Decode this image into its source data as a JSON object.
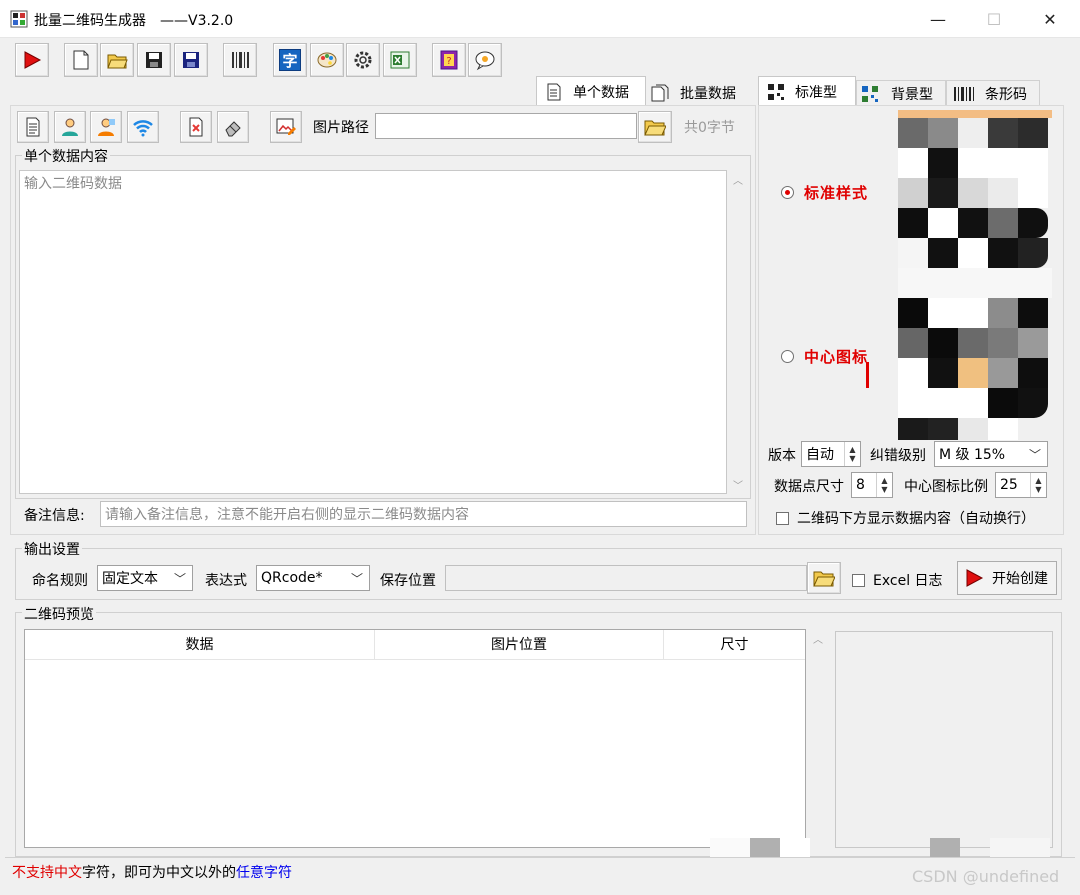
{
  "window": {
    "title": "批量二维码生成器　——V3.2.0",
    "minimize_glyph": "—",
    "maximize_glyph": "☐",
    "close_glyph": "✕"
  },
  "toolbar": {
    "buttons": [
      "play-icon",
      "new-file-icon",
      "open-folder-icon",
      "save-icon",
      "save-as-icon",
      "barcode-reader-icon",
      "font-icon",
      "palette-icon",
      "settings-icon",
      "excel-icon",
      "help-book-icon",
      "chat-icon"
    ],
    "font_glyph": "字"
  },
  "left_tabs": {
    "single": "单个数据",
    "batch": "批量数据"
  },
  "right_tabs": {
    "standard": "标准型",
    "background": "背景型",
    "barcode": "条形码"
  },
  "sub_toolbar": {
    "image_path_label": "图片路径",
    "image_path_value": "",
    "byte_count": "共0字节"
  },
  "single_content": {
    "group_label": "单个数据内容",
    "placeholder": "输入二维码数据"
  },
  "note": {
    "label": "备注信息:",
    "placeholder": "请输入备注信息，注意不能开启右侧的显示二维码数据内容"
  },
  "style_options": {
    "standard": "标准样式",
    "center_icon": "中心图标"
  },
  "qr_settings": {
    "version_label": "版本",
    "version_value": "自动",
    "ecc_label": "纠错级别",
    "ecc_value": "M 级 15%",
    "dot_size_label": "数据点尺寸",
    "dot_size_value": "8",
    "center_ratio_label": "中心图标比例",
    "center_ratio_value": "25",
    "show_data_label": "二维码下方显示数据内容（自动换行）"
  },
  "output": {
    "group_label": "输出设置",
    "naming_label": "命名规则",
    "naming_value": "固定文本",
    "expression_label": "表达式",
    "expression_value": "QRcode*",
    "save_location_label": "保存位置",
    "save_location_value": "",
    "excel_log_label": "Excel 日志",
    "start_button": "开始创建"
  },
  "preview": {
    "group_label": "二维码预览",
    "columns": [
      "数据",
      "图片位置",
      "尺寸"
    ]
  },
  "status": {
    "part1": "不支持中文",
    "part2": "字符，即可为中文以外的",
    "part3": "任意字符"
  },
  "watermark": "CSDN @undefined",
  "colors": {
    "accent_red": "#e00000",
    "link_blue": "#0000ee"
  }
}
